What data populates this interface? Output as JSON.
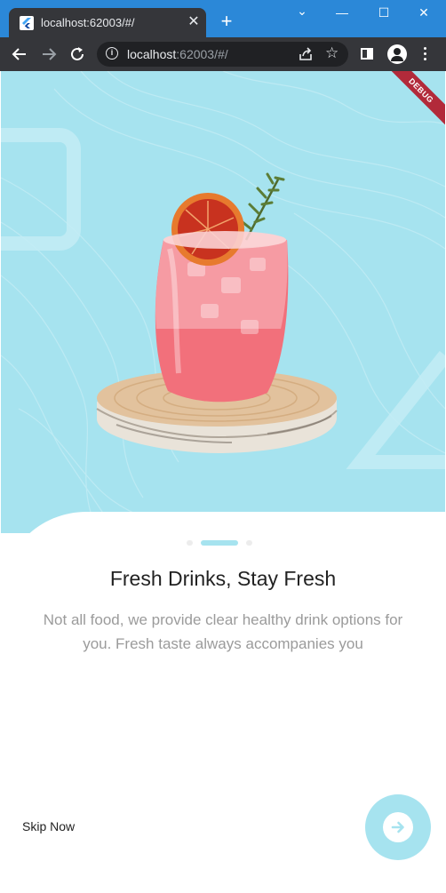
{
  "browser": {
    "tab_title": "localhost:62003/#/",
    "tab_close": "✕",
    "new_tab": "+",
    "window_controls": {
      "minimize": "—",
      "restore": "☐",
      "close": "✕",
      "dropdown": "⌄"
    },
    "url_host": "localhost",
    "url_rest": ":62003/#/",
    "star": "☆"
  },
  "app": {
    "debug_banner": "DEBUG",
    "page_indicator": {
      "count": 3,
      "active_index": 1
    },
    "title": "Fresh Drinks, Stay Fresh",
    "description": "Not all food, we provide clear healthy drink options for you. Fresh taste always accompanies you",
    "skip_label": "Skip Now",
    "next_icon": "arrow-right-icon",
    "colors": {
      "accent": "#a6e3ef",
      "debug": "#b22a3a",
      "title": "#222222",
      "desc": "#9b9b9b"
    }
  }
}
